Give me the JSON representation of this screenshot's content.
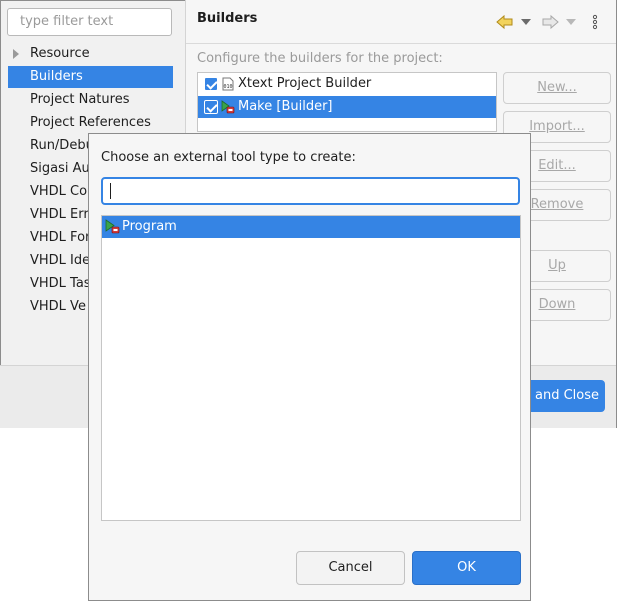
{
  "preferences": {
    "filter_placeholder": "type filter text",
    "tree": [
      {
        "label": "Resource",
        "selected": false
      },
      {
        "label": "Builders",
        "selected": true
      },
      {
        "label": "Project Natures",
        "selected": false
      },
      {
        "label": "Project References",
        "selected": false
      },
      {
        "label": "Run/Debu",
        "selected": false
      },
      {
        "label": "Sigasi Au",
        "selected": false
      },
      {
        "label": "VHDL Co",
        "selected": false
      },
      {
        "label": "VHDL Err",
        "selected": false
      },
      {
        "label": "VHDL For",
        "selected": false
      },
      {
        "label": "VHDL Ide",
        "selected": false
      },
      {
        "label": "VHDL Tas",
        "selected": false
      },
      {
        "label": "VHDL Ve",
        "selected": false
      }
    ],
    "page_title": "Builders",
    "description": "Configure the builders for the project:",
    "builders": [
      {
        "label": "Xtext Project Builder",
        "checked": true,
        "icon": "xtext-builder-icon"
      },
      {
        "label": "Make [Builder]",
        "checked": true,
        "icon": "external-tool-icon",
        "selected": true
      }
    ],
    "buttons": {
      "new": "New...",
      "import": "Import...",
      "edit": "Edit...",
      "remove": "Remove",
      "up": "Up",
      "down": "Down",
      "apply_close": "and Close"
    },
    "toolbar_icons": [
      "back-arrow-icon",
      "back-menu-icon",
      "forward-arrow-icon",
      "forward-menu-icon",
      "view-menu-icon"
    ]
  },
  "dialog": {
    "prompt": "Choose an external tool type to create:",
    "search_value": "",
    "items": [
      {
        "label": "Program",
        "icon": "program-launch-icon",
        "selected": true
      }
    ],
    "cancel_label": "Cancel",
    "ok_label": "OK"
  },
  "colors": {
    "accent": "#3584e4",
    "disabled_text": "#a8a8a8",
    "window_bg": "#f1f1f1"
  }
}
